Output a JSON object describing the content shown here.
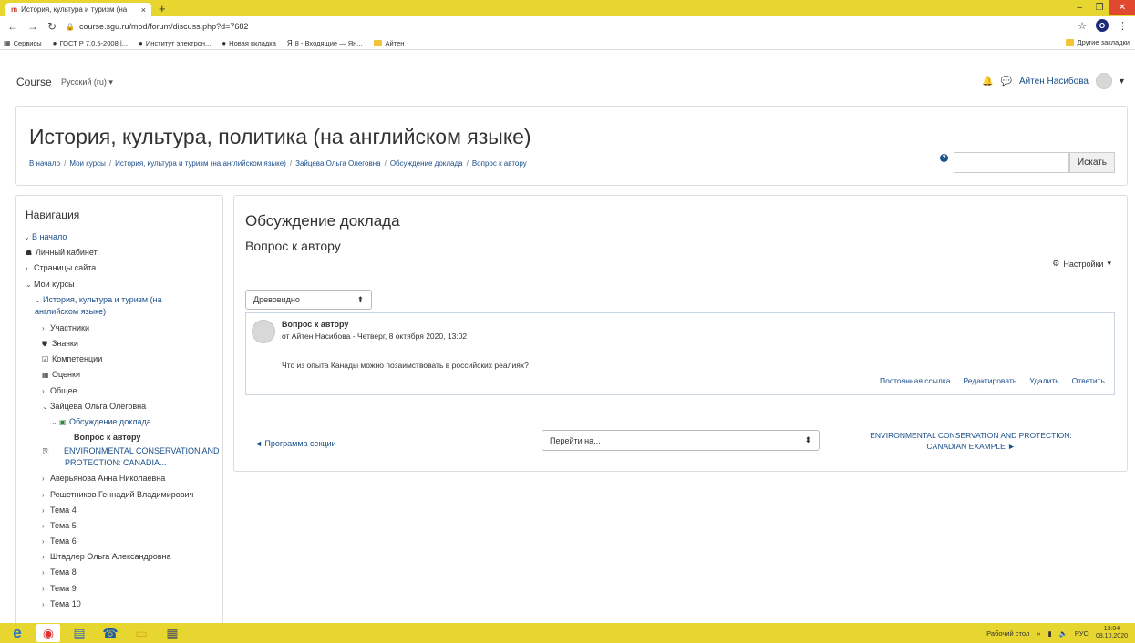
{
  "browser": {
    "tab_title": "История, культура и туризм (на",
    "tab_close": "×",
    "new_tab": "+",
    "url": "course.sgu.ru/mod/forum/discuss.php?d=7682",
    "profile_initial": "O",
    "bookmarks": [
      "Сервисы",
      "ГОСТ Р 7.0.5-2008 |...",
      "Институт электрон...",
      "Новая вкладка",
      "8 - Входящие — Ян...",
      "Айтен"
    ],
    "bookmarks_other": "Другие закладки"
  },
  "navbar": {
    "brand": "Course",
    "language": "Русский (ru) ▾",
    "user_name": "Айтен Насибова"
  },
  "header": {
    "title": "История, культура, политика (на английском языке)",
    "breadcrumb": [
      "В начало",
      "Мои курсы",
      "История, культура и туризм (на английском языке)",
      "Зайцева Ольга Олеговна",
      "Обсуждение доклада",
      "Вопрос к автору"
    ],
    "search_button": "Искать"
  },
  "sidebar": {
    "heading": "Навигация",
    "items": [
      "В начало",
      "Личный кабинет",
      "Страницы сайта",
      "Мои курсы",
      "История, культура и туризм (на английском языке)",
      "Участники",
      "Значки",
      "Компетенции",
      "Оценки",
      "Общее",
      "Зайцева Ольга Олеговна",
      "Обсуждение доклада",
      "Вопрос к автору",
      "ENVIRONMENTAL CONSERVATION AND PROTECTION: CANADIA...",
      "Аверьянова Анна Николаевна",
      "Решетников Геннадий Владимирович",
      "Тема 4",
      "Тема 5",
      "Тема 6",
      "Штадлер Ольга Александровна",
      "Тема 8",
      "Тема 9",
      "Тема 10"
    ]
  },
  "main": {
    "forum_title": "Обсуждение доклада",
    "discussion_title": "Вопрос к автору",
    "settings_label": "Настройки",
    "display_mode": "Древовидно",
    "post": {
      "subject": "Вопрос к автору",
      "meta": "от Айтен Насибова - Четверг, 8 октября 2020, 13:02",
      "body": "Что из опыта Канады можно позаимствовать в российских реалиях?",
      "actions": [
        "Постоянная ссылка",
        "Редактировать",
        "Удалить",
        "Ответить"
      ]
    },
    "section_link": "◄ Программа секции",
    "jump_select": "Перейти на...",
    "next_link": "ENVIRONMENTAL CONSERVATION AND PROTECTION: CANADIAN EXAMPLE ►"
  },
  "taskbar": {
    "desktop_label": "Рабочий стол",
    "lang": "РУС",
    "time": "13:04",
    "date": "08.10.2020"
  }
}
